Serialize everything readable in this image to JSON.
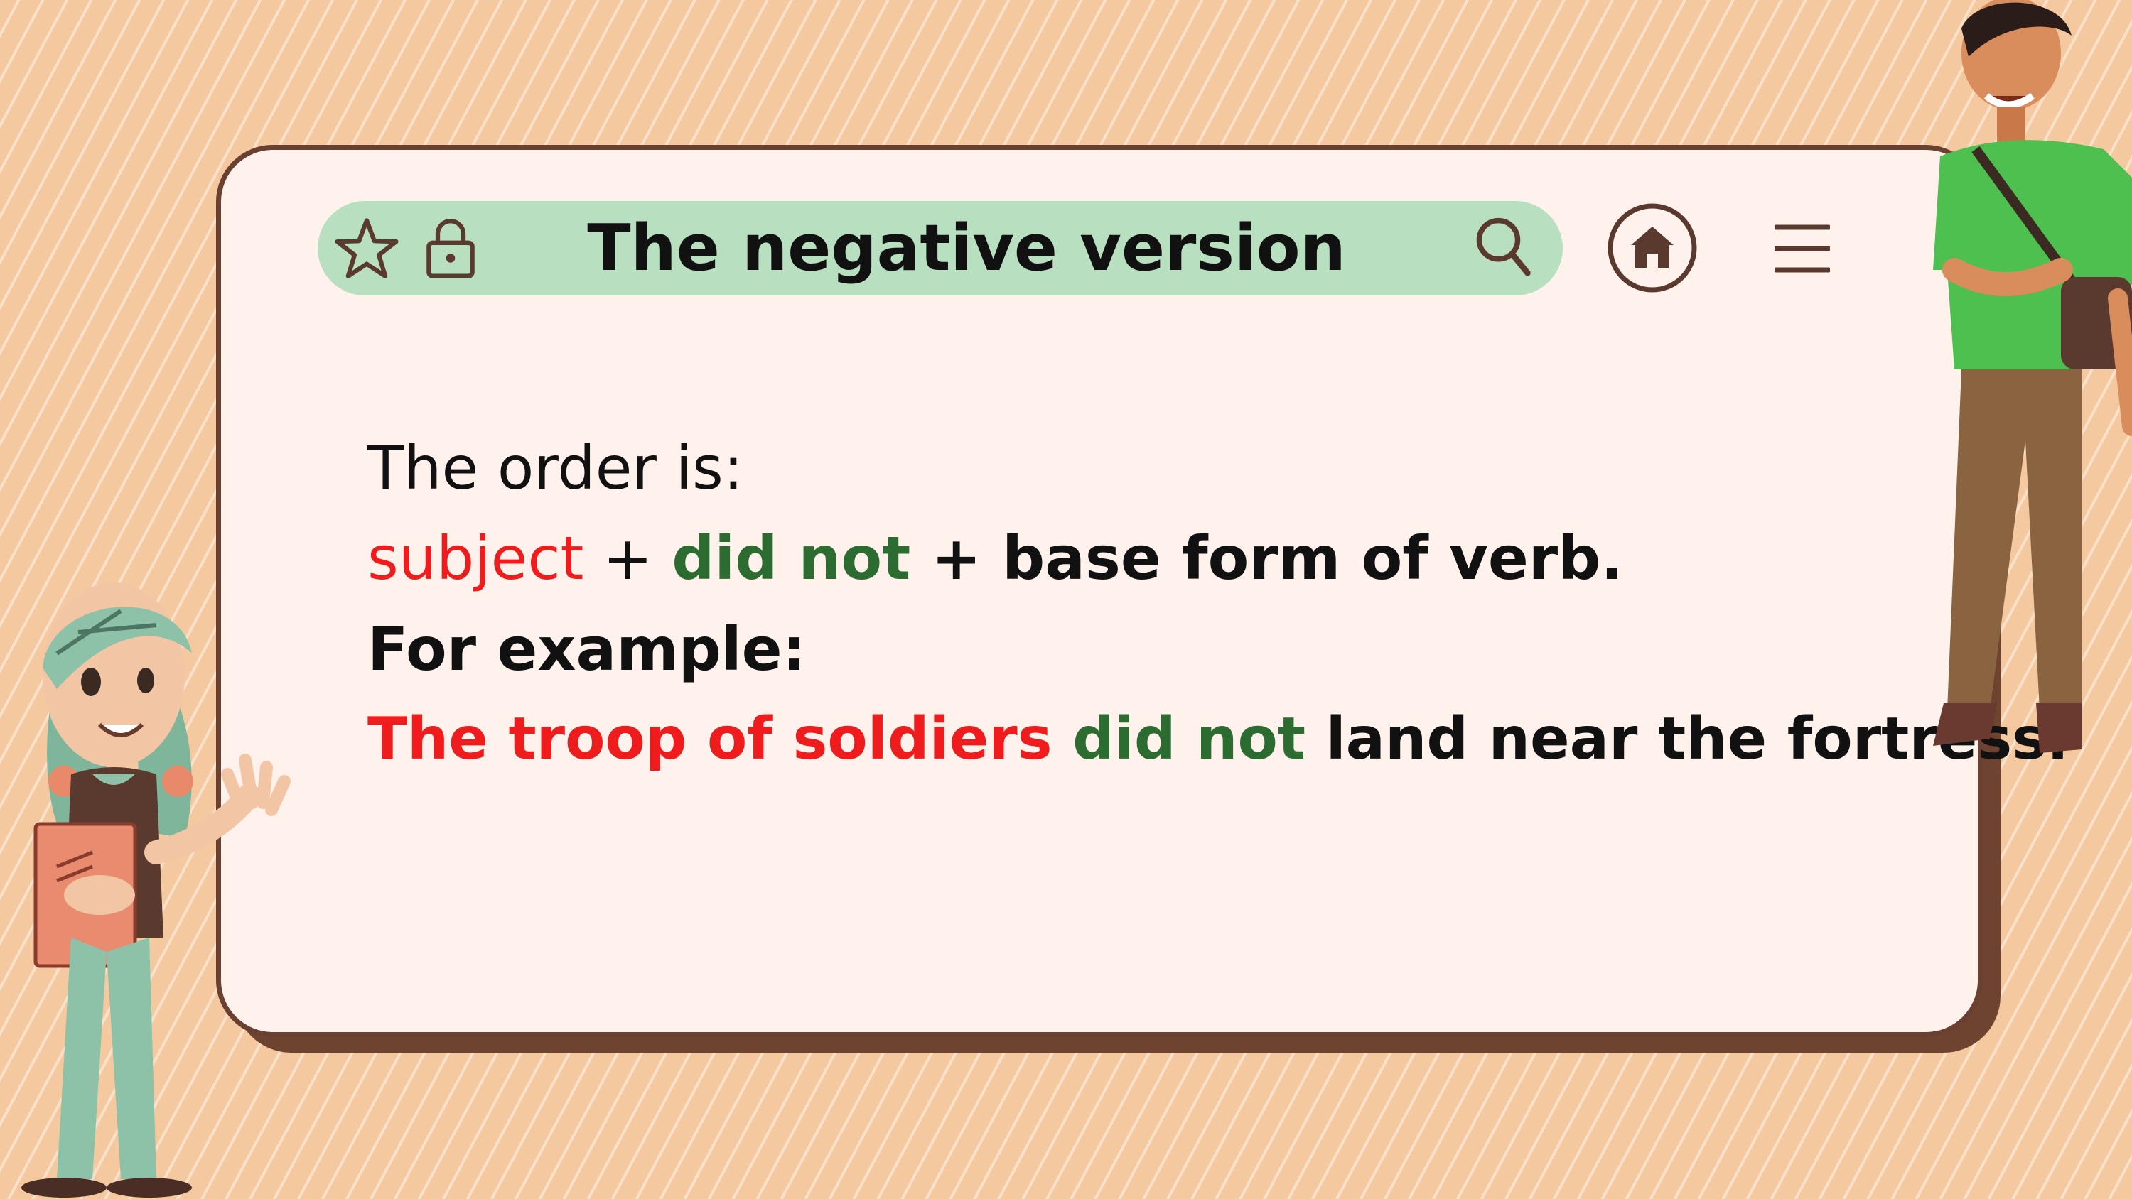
{
  "toolbar": {
    "title": "The negative version",
    "icons": [
      "star-icon",
      "lock-icon",
      "search-icon",
      "home-icon",
      "hamburger-menu-icon"
    ]
  },
  "content": {
    "line1": "The order is:",
    "line2": {
      "subject": "subject",
      "plus1": " + ",
      "did_not": "did not",
      "rest": " + base form of verb."
    },
    "line3": "For example:",
    "line4": {
      "subject": "The troop of soldiers",
      "space1": " ",
      "did_not": "did not",
      "rest": " land near the fortress."
    }
  },
  "colors": {
    "background": "#f5c9a0",
    "card": "#fff2ec",
    "card_border": "#6a4031",
    "address_bar": "#b8dfc0",
    "icon": "#5a3a2e",
    "subject_red": "#ee1c1c",
    "auxiliary_green": "#2c6c30"
  }
}
